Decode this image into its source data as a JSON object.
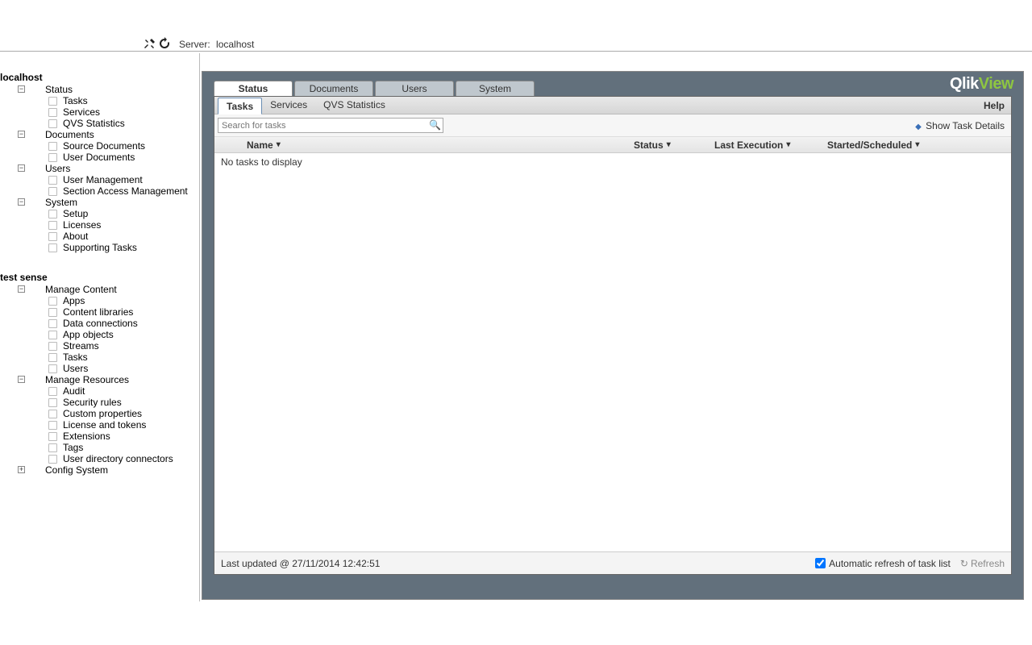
{
  "top": {
    "server_label": "Server:",
    "server_value": "localhost"
  },
  "tree": {
    "roots": [
      {
        "label": "localhost",
        "groups": [
          {
            "label": "Status",
            "expanded": true,
            "items": [
              "Tasks",
              "Services",
              "QVS Statistics"
            ]
          },
          {
            "label": "Documents",
            "expanded": true,
            "items": [
              "Source Documents",
              "User Documents"
            ]
          },
          {
            "label": "Users",
            "expanded": true,
            "items": [
              "User Management",
              "Section Access Management"
            ]
          },
          {
            "label": "System",
            "expanded": true,
            "items": [
              "Setup",
              "Licenses",
              "About",
              "Supporting Tasks"
            ]
          }
        ]
      },
      {
        "label": "test sense",
        "groups": [
          {
            "label": "Manage Content",
            "expanded": true,
            "items": [
              "Apps",
              "Content libraries",
              "Data connections",
              "App objects",
              "Streams",
              "Tasks",
              "Users"
            ]
          },
          {
            "label": "Manage Resources",
            "expanded": true,
            "items": [
              "Audit",
              "Security rules",
              "Custom properties",
              "License and tokens",
              "Extensions",
              "Tags",
              "User directory connectors"
            ]
          },
          {
            "label": "Config System",
            "expanded": false,
            "items": []
          }
        ]
      }
    ]
  },
  "brand": {
    "a": "Qlik",
    "b": "View"
  },
  "tabs": [
    "Status",
    "Documents",
    "Users",
    "System"
  ],
  "active_tab": 0,
  "subtabs": [
    "Tasks",
    "Services",
    "QVS Statistics"
  ],
  "active_subtab": 0,
  "help_label": "Help",
  "search_placeholder": "Search for tasks",
  "show_details_label": "Show Task Details",
  "columns": [
    "Name",
    "Status",
    "Last Execution",
    "Started/Scheduled"
  ],
  "empty_message": "No tasks to display",
  "footer": {
    "last_updated": "Last updated @ 27/11/2014 12:42:51",
    "auto_refresh_label": "Automatic refresh of task list",
    "auto_refresh_checked": true,
    "refresh_label": "Refresh"
  }
}
